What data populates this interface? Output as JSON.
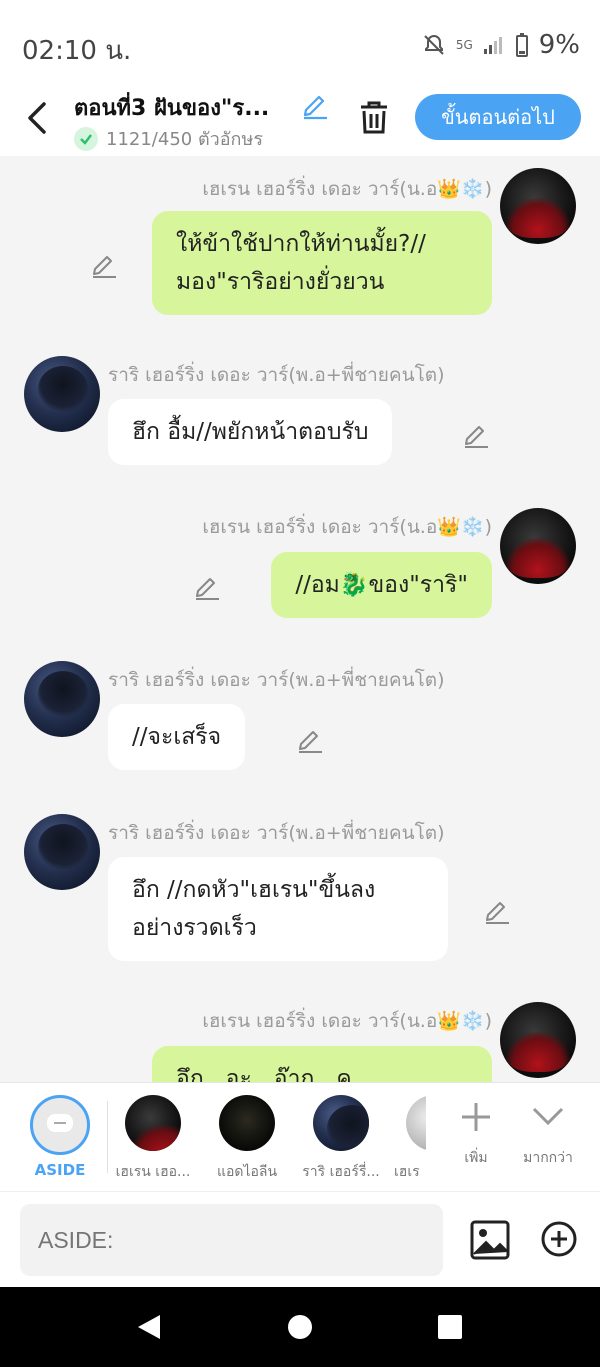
{
  "status_bar": {
    "time": "02:10 น.",
    "network": "5G",
    "battery": "9%"
  },
  "header": {
    "title": "ตอนที่3 ฝันของ\"ร...",
    "char_count": "1121/450 ตัวอักษร",
    "next_button": "ขั้นตอนต่อไป"
  },
  "messages": [
    {
      "side": "right",
      "sender": "เฮเรน เฮอร์ริ่ง เดอะ วาร์(น.อ👑❄️)",
      "lines": [
        "ให้ข้าใช้ปากให้ท่านมั้ย?//",
        "มอง\"ราริอย่างยั่วยวน"
      ]
    },
    {
      "side": "left",
      "sender": "ราริ เฮอร์ริ่ง เดอะ วาร์(พ.อ+พี่ชายคนโต)",
      "lines": [
        "ฮึก อื้ม//พยักหน้าตอบรับ"
      ]
    },
    {
      "side": "right",
      "sender": "เฮเรน เฮอร์ริ่ง เดอะ วาร์(น.อ👑❄️)",
      "lines": [
        "//อม🐉ของ\"ราริ\""
      ]
    },
    {
      "side": "left",
      "sender": "ราริ เฮอร์ริ่ง เดอะ วาร์(พ.อ+พี่ชายคนโต)",
      "lines": [
        "//จะเสร็จ"
      ]
    },
    {
      "side": "left",
      "sender": "ราริ เฮอร์ริ่ง เดอะ วาร์(พ.อ+พี่ชายคนโต)",
      "lines": [
        "อึก //กดหัว\"เฮเรน\"ขึ้นลง",
        "อย่างรวดเร็ว"
      ]
    },
    {
      "side": "right",
      "sender": "เฮเรน เฮอร์ริ่ง เดอะ วาร์(น.อ👑❄️)",
      "lines": [
        "อึก...อะ...อ๊าก...ค"
      ]
    }
  ],
  "characters": {
    "aside_label": "ASIDE",
    "items": [
      {
        "label": "เฮเรน เฮอ..."
      },
      {
        "label": "แอดไอลีน"
      },
      {
        "label": "ราริ เฮอร์รี่..."
      },
      {
        "label": "เฮเร"
      }
    ],
    "add_label": "เพิ่ม",
    "more_label": "มากกว่า"
  },
  "input": {
    "placeholder": "ASIDE:"
  },
  "colors": {
    "accent": "#4aa3f3",
    "out_bubble": "#d7f59a",
    "in_bubble": "#ffffff"
  }
}
